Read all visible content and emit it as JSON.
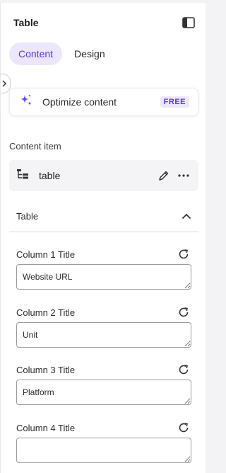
{
  "header": {
    "title": "Table"
  },
  "tabs": [
    {
      "label": "Content",
      "active": true
    },
    {
      "label": "Design",
      "active": false
    }
  ],
  "optimize": {
    "label": "Optimize content",
    "badge": "FREE"
  },
  "content_item": {
    "section_label": "Content item",
    "label": "table"
  },
  "group": {
    "title": "Table",
    "expanded": true
  },
  "fields": [
    {
      "label": "Column 1 Title",
      "value": "Website URL"
    },
    {
      "label": "Column 2 Title",
      "value": "Unit"
    },
    {
      "label": "Column 3 Title",
      "value": "Platform"
    },
    {
      "label": "Column 4 Title",
      "value": ""
    }
  ],
  "colors": {
    "accent": "#5b38e0",
    "accent_bg": "#ece6ff"
  }
}
